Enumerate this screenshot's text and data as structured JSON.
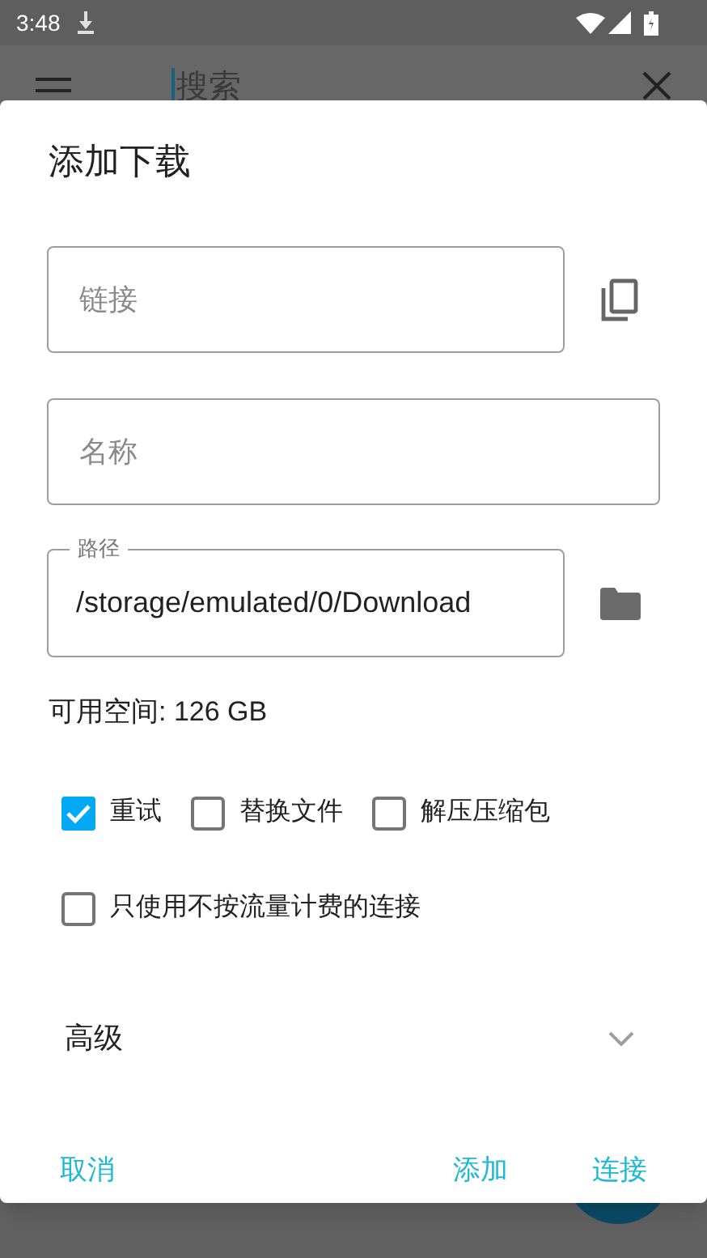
{
  "status_bar": {
    "time": "3:48"
  },
  "app_bar": {
    "search": {
      "placeholder": "搜索"
    }
  },
  "dialog": {
    "title": "添加下载",
    "link_field": {
      "placeholder": "链接"
    },
    "name_field": {
      "placeholder": "名称"
    },
    "path_field": {
      "label": "路径",
      "value": "/storage/emulated/0/Download"
    },
    "free_space": "可用空间: 126 GB",
    "options": [
      {
        "label": "重试",
        "checked": true
      },
      {
        "label": "替换文件",
        "checked": false
      },
      {
        "label": "解压压缩包",
        "checked": false
      }
    ],
    "metered_option": {
      "label": "只使用不按流量计费的连接",
      "checked": false
    },
    "advanced": {
      "label": "高级",
      "expanded": false
    },
    "buttons": [
      {
        "label": "取消"
      },
      {
        "label": "添加"
      },
      {
        "label": "连接"
      }
    ]
  }
}
